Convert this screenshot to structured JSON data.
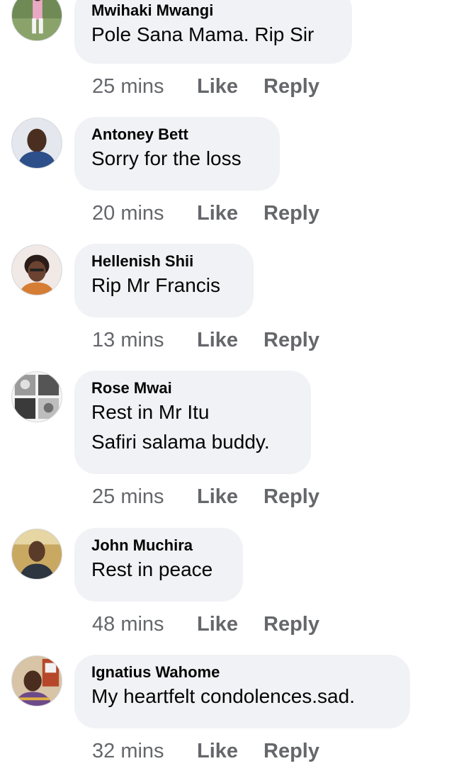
{
  "comments": [
    {
      "author": "Mwihaki Mwangi",
      "text": [
        "Pole Sana Mama. Rip Sir"
      ],
      "time": "25 mins",
      "like_label": "Like",
      "reply_label": "Reply",
      "avatar_icon": "user-avatar-photo"
    },
    {
      "author": "Antoney Bett",
      "text": [
        "Sorry for the loss"
      ],
      "time": "20 mins",
      "like_label": "Like",
      "reply_label": "Reply",
      "avatar_icon": "user-avatar-photo"
    },
    {
      "author": "Hellenish Shii",
      "text": [
        "Rip Mr Francis"
      ],
      "time": "13 mins",
      "like_label": "Like",
      "reply_label": "Reply",
      "avatar_icon": "user-avatar-photo"
    },
    {
      "author": "Rose Mwai",
      "text": [
        "Rest in Mr Itu",
        "Safiri salama buddy."
      ],
      "time": "25 mins",
      "like_label": "Like",
      "reply_label": "Reply",
      "avatar_icon": "user-avatar-photo"
    },
    {
      "author": "John Muchira",
      "text": [
        "Rest in peace"
      ],
      "time": "48 mins",
      "like_label": "Like",
      "reply_label": "Reply",
      "avatar_icon": "user-avatar-photo"
    },
    {
      "author": "Ignatius Wahome",
      "text": [
        "My heartfelt condolences.sad."
      ],
      "time": "32 mins",
      "like_label": "Like",
      "reply_label": "Reply",
      "avatar_icon": "user-avatar-photo"
    }
  ],
  "colors": {
    "bubble_background": "#f0f2f5",
    "author_text": "#050505",
    "meta_text": "#65676b"
  }
}
